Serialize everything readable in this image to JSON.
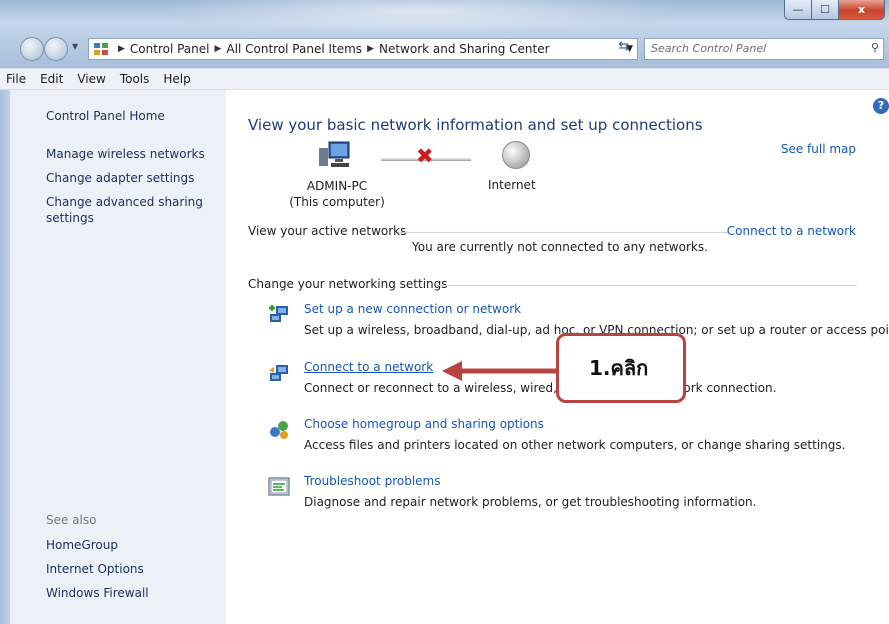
{
  "window": {
    "buttons": {
      "minimize": "—",
      "maximize": "☐",
      "close": "x"
    }
  },
  "address_bar": {
    "crumbs": [
      "Control Panel",
      "All Control Panel Items",
      "Network and Sharing Center"
    ],
    "search_placeholder": "Search Control Panel"
  },
  "menu": [
    "File",
    "Edit",
    "View",
    "Tools",
    "Help"
  ],
  "sidebar": {
    "home": "Control Panel Home",
    "links": [
      "Manage wireless networks",
      "Change adapter settings",
      "Change advanced sharing settings"
    ],
    "see_also_title": "See also",
    "see_also": [
      "HomeGroup",
      "Internet Options",
      "Windows Firewall"
    ]
  },
  "main": {
    "heading": "View your basic network information and set up connections",
    "see_full_map": "See full map",
    "computer_name": "ADMIN-PC",
    "computer_sub": "(This computer)",
    "internet_label": "Internet",
    "active_networks_title": "View your active networks",
    "connect_link": "Connect to a network",
    "not_connected": "You are currently not connected to any networks.",
    "change_settings_title": "Change your networking settings",
    "tasks": [
      {
        "title": "Set up a new connection or network",
        "desc": "Set up a wireless, broadband, dial-up, ad hoc, or VPN connection; or set up a router or access point.",
        "icon": "new-connection-icon"
      },
      {
        "title": "Connect to a network",
        "desc": "Connect or reconnect to a wireless, wired, dial-up, or VPN network connection.",
        "icon": "connect-network-icon"
      },
      {
        "title": "Choose homegroup and sharing options",
        "desc": "Access files and printers located on other network computers, or change sharing settings.",
        "icon": "homegroup-icon"
      },
      {
        "title": "Troubleshoot problems",
        "desc": "Diagnose and repair network problems, or get troubleshooting information.",
        "icon": "troubleshoot-icon"
      }
    ]
  },
  "annotation": {
    "label": "1.คลิก",
    "color": "#b8443f"
  }
}
